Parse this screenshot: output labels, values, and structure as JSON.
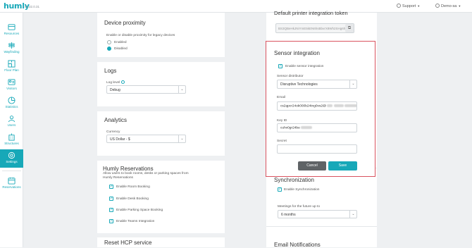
{
  "header": {
    "logo": "humly",
    "version": "v1.32.0.31",
    "support": "Support",
    "user": "Demo-sa"
  },
  "sidebar": {
    "items": [
      {
        "label": "Resources",
        "icon": "resources-icon"
      },
      {
        "label": "Wayfinding",
        "icon": "wayfinding-icon"
      },
      {
        "label": "Floor Plan",
        "icon": "floor-plan-icon"
      },
      {
        "label": "Visitors",
        "icon": "visitors-icon"
      },
      {
        "label": "Statistics",
        "icon": "statistics-icon"
      },
      {
        "label": "Users",
        "icon": "users-icon"
      },
      {
        "label": "Structures",
        "icon": "structures-icon"
      },
      {
        "label": "Settings",
        "icon": "gear-icon"
      },
      {
        "label": "Reservations",
        "icon": "reservations-icon"
      }
    ]
  },
  "device_proximity": {
    "title": "Device proximity",
    "description": "Enable or disable proximity for legacy devices",
    "options": [
      "Enabled",
      "Disabled"
    ],
    "selected": "Disabled"
  },
  "logs": {
    "title": "Logs",
    "level_label": "Log level",
    "level_value": "Debug"
  },
  "analytics": {
    "title": "Analytics",
    "currency_label": "Currency",
    "currency_value": "US Dollar - $"
  },
  "reservations": {
    "title": "Humly Reservations",
    "description_line1": "Allow users to book rooms, desks or parking spaces from",
    "description_line2": "Humly Reservations",
    "options": [
      "Enable Room Booking",
      "Enable Desk Booking",
      "Enable Parking Space Booking",
      "Enable Teams Integration"
    ]
  },
  "reset_hcp": {
    "title": "Reset HCP service"
  },
  "printer_token": {
    "title": "Default printer integration token",
    "value": "BS3QBeHkJNiYmE5kEN6hsBbvrX8Wh2SHg6ht"
  },
  "sensor": {
    "title": "Sensor integration",
    "enable_label": "Enable sensor integration",
    "distributor_label": "Sensor distributor",
    "distributor_value": "Disruptive Technologies",
    "email_label": "Email",
    "email_value": "cs2qpcr24ok000b24tng0vs2@",
    "keyid_label": "Key ID",
    "keyid_value": "cuhv0gr24be",
    "secret_label": "Secret",
    "secret_value": "",
    "cancel": "Cancel",
    "save": "Save",
    "highlight_color": "#d9535f"
  },
  "sync": {
    "title": "Synchronization",
    "enable_label": "Enable Synchronization",
    "meetings_label": "Meetings for the future up to",
    "meetings_value": "6 months"
  },
  "email_notif": {
    "title": "Email Notifications"
  },
  "colors": {
    "accent": "#17a8b8",
    "cancel": "#5f6366"
  }
}
